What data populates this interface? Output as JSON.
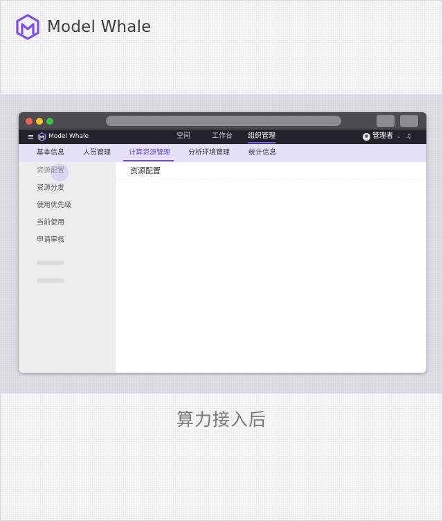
{
  "brand": {
    "name": "Model Whale",
    "accent": "#7b4fe6"
  },
  "window": {
    "traffic_lights": [
      "#f25f58",
      "#fbbd2e",
      "#39c545"
    ],
    "topnav": {
      "menu_icon": "≡",
      "brand": "Model Whale",
      "items": [
        {
          "label": "空间"
        },
        {
          "label": "工作台"
        },
        {
          "label": "组织管理"
        }
      ],
      "active_index": 2,
      "user": "管理者",
      "caret": "⌄",
      "bell_icon": "♫"
    },
    "subnav": {
      "items": [
        {
          "label": "基本信息"
        },
        {
          "label": "人员管理"
        },
        {
          "label": "计算资源管理"
        },
        {
          "label": "分析环境管理"
        },
        {
          "label": "统计信息"
        }
      ],
      "active_index": 2
    },
    "sidebar": {
      "items": [
        {
          "label": "资源配置"
        },
        {
          "label": "资源分发"
        },
        {
          "label": "使用优先级"
        },
        {
          "label": "当前使用"
        },
        {
          "label": "申请审核"
        }
      ],
      "active_index": 0
    },
    "content": {
      "title": "资源配置"
    }
  },
  "caption": "算力接入后"
}
